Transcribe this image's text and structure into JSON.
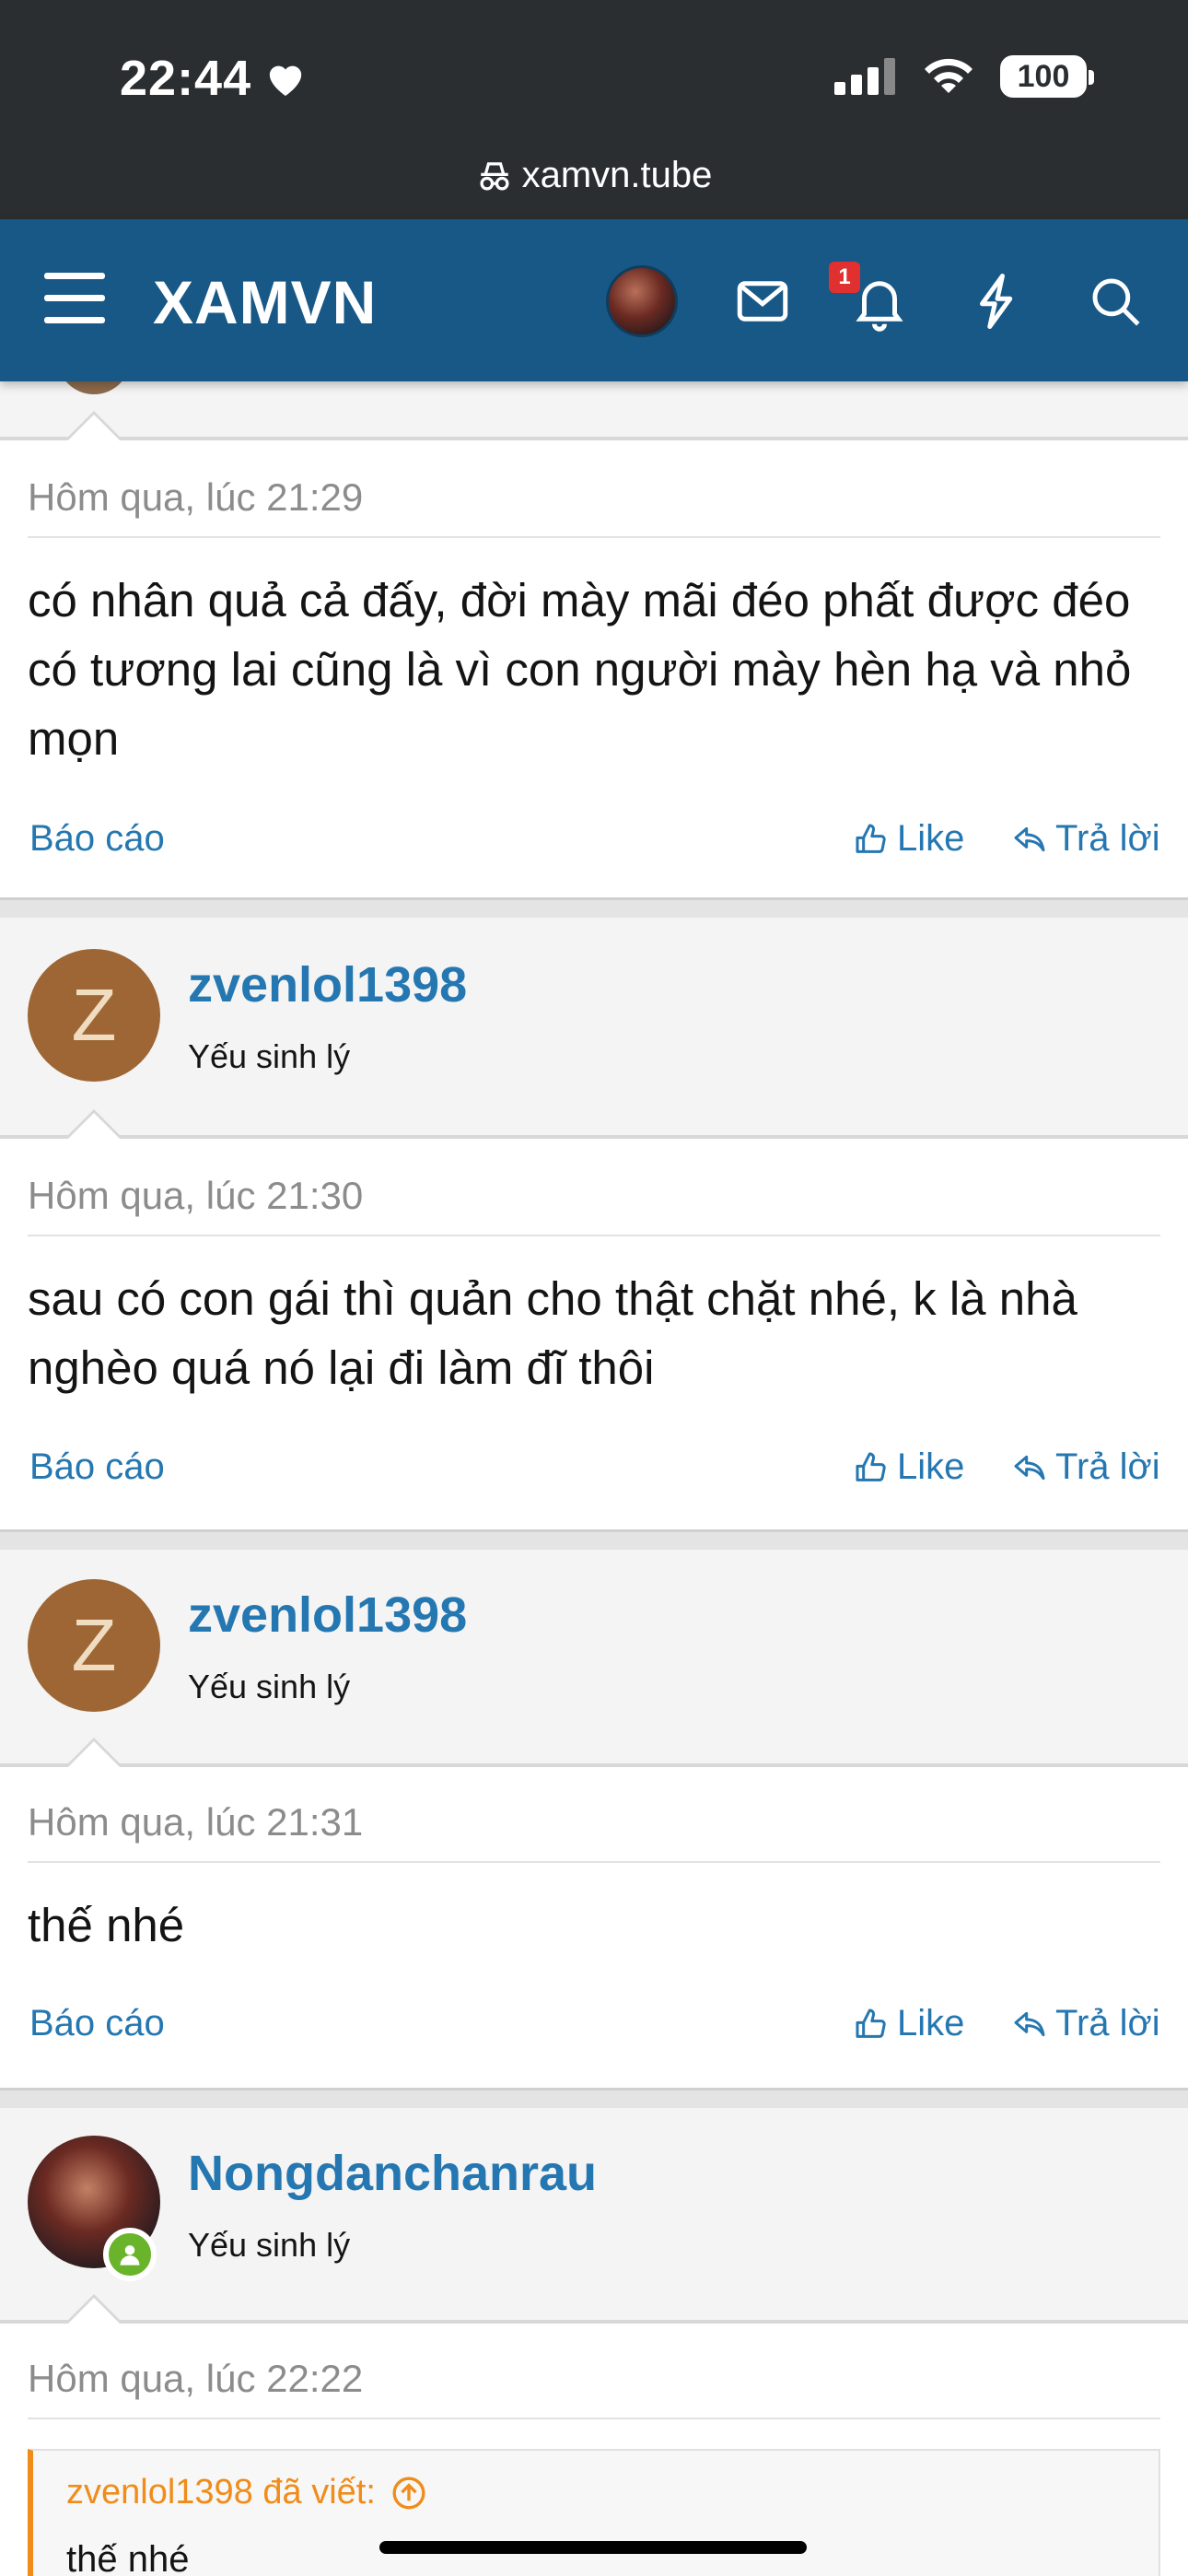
{
  "status_bar": {
    "time": "22:44",
    "battery": "100"
  },
  "browser": {
    "url": "xamvn.tube"
  },
  "header": {
    "logo": "XAMVN",
    "notification_count": "1"
  },
  "posts": [
    {
      "date": "Hôm qua, lúc 21:29",
      "text": "có nhân quả cả đấy, đời mày mãi đéo phất được đéo có tương lai cũng là vì con người mày hèn hạ và nhỏ mọn",
      "report": "Báo cáo",
      "like": "Like",
      "reply": "Trả lời"
    },
    {
      "user": {
        "name": "zvenlol1398",
        "title": "Yếu sinh lý",
        "initial": "Z"
      },
      "date": "Hôm qua, lúc 21:30",
      "text": "sau có con gái thì quản cho thật chặt nhé, k là nhà nghèo quá nó lại đi làm đĩ thôi",
      "report": "Báo cáo",
      "like": "Like",
      "reply": "Trả lời"
    },
    {
      "user": {
        "name": "zvenlol1398",
        "title": "Yếu sinh lý",
        "initial": "Z"
      },
      "date": "Hôm qua, lúc 21:31",
      "text": "thế nhé",
      "report": "Báo cáo",
      "like": "Like",
      "reply": "Trả lời"
    },
    {
      "user": {
        "name": "Nongdanchanrau",
        "title": "Yếu sinh lý"
      },
      "date": "Hôm qua, lúc 22:22",
      "quote": {
        "author": "zvenlol1398 đã viết:",
        "text": "thế nhé"
      }
    }
  ],
  "colors": {
    "header_bg": "#185886",
    "link": "#2577b1",
    "quote_accent": "#f08c1a",
    "online": "#6ab42b"
  }
}
